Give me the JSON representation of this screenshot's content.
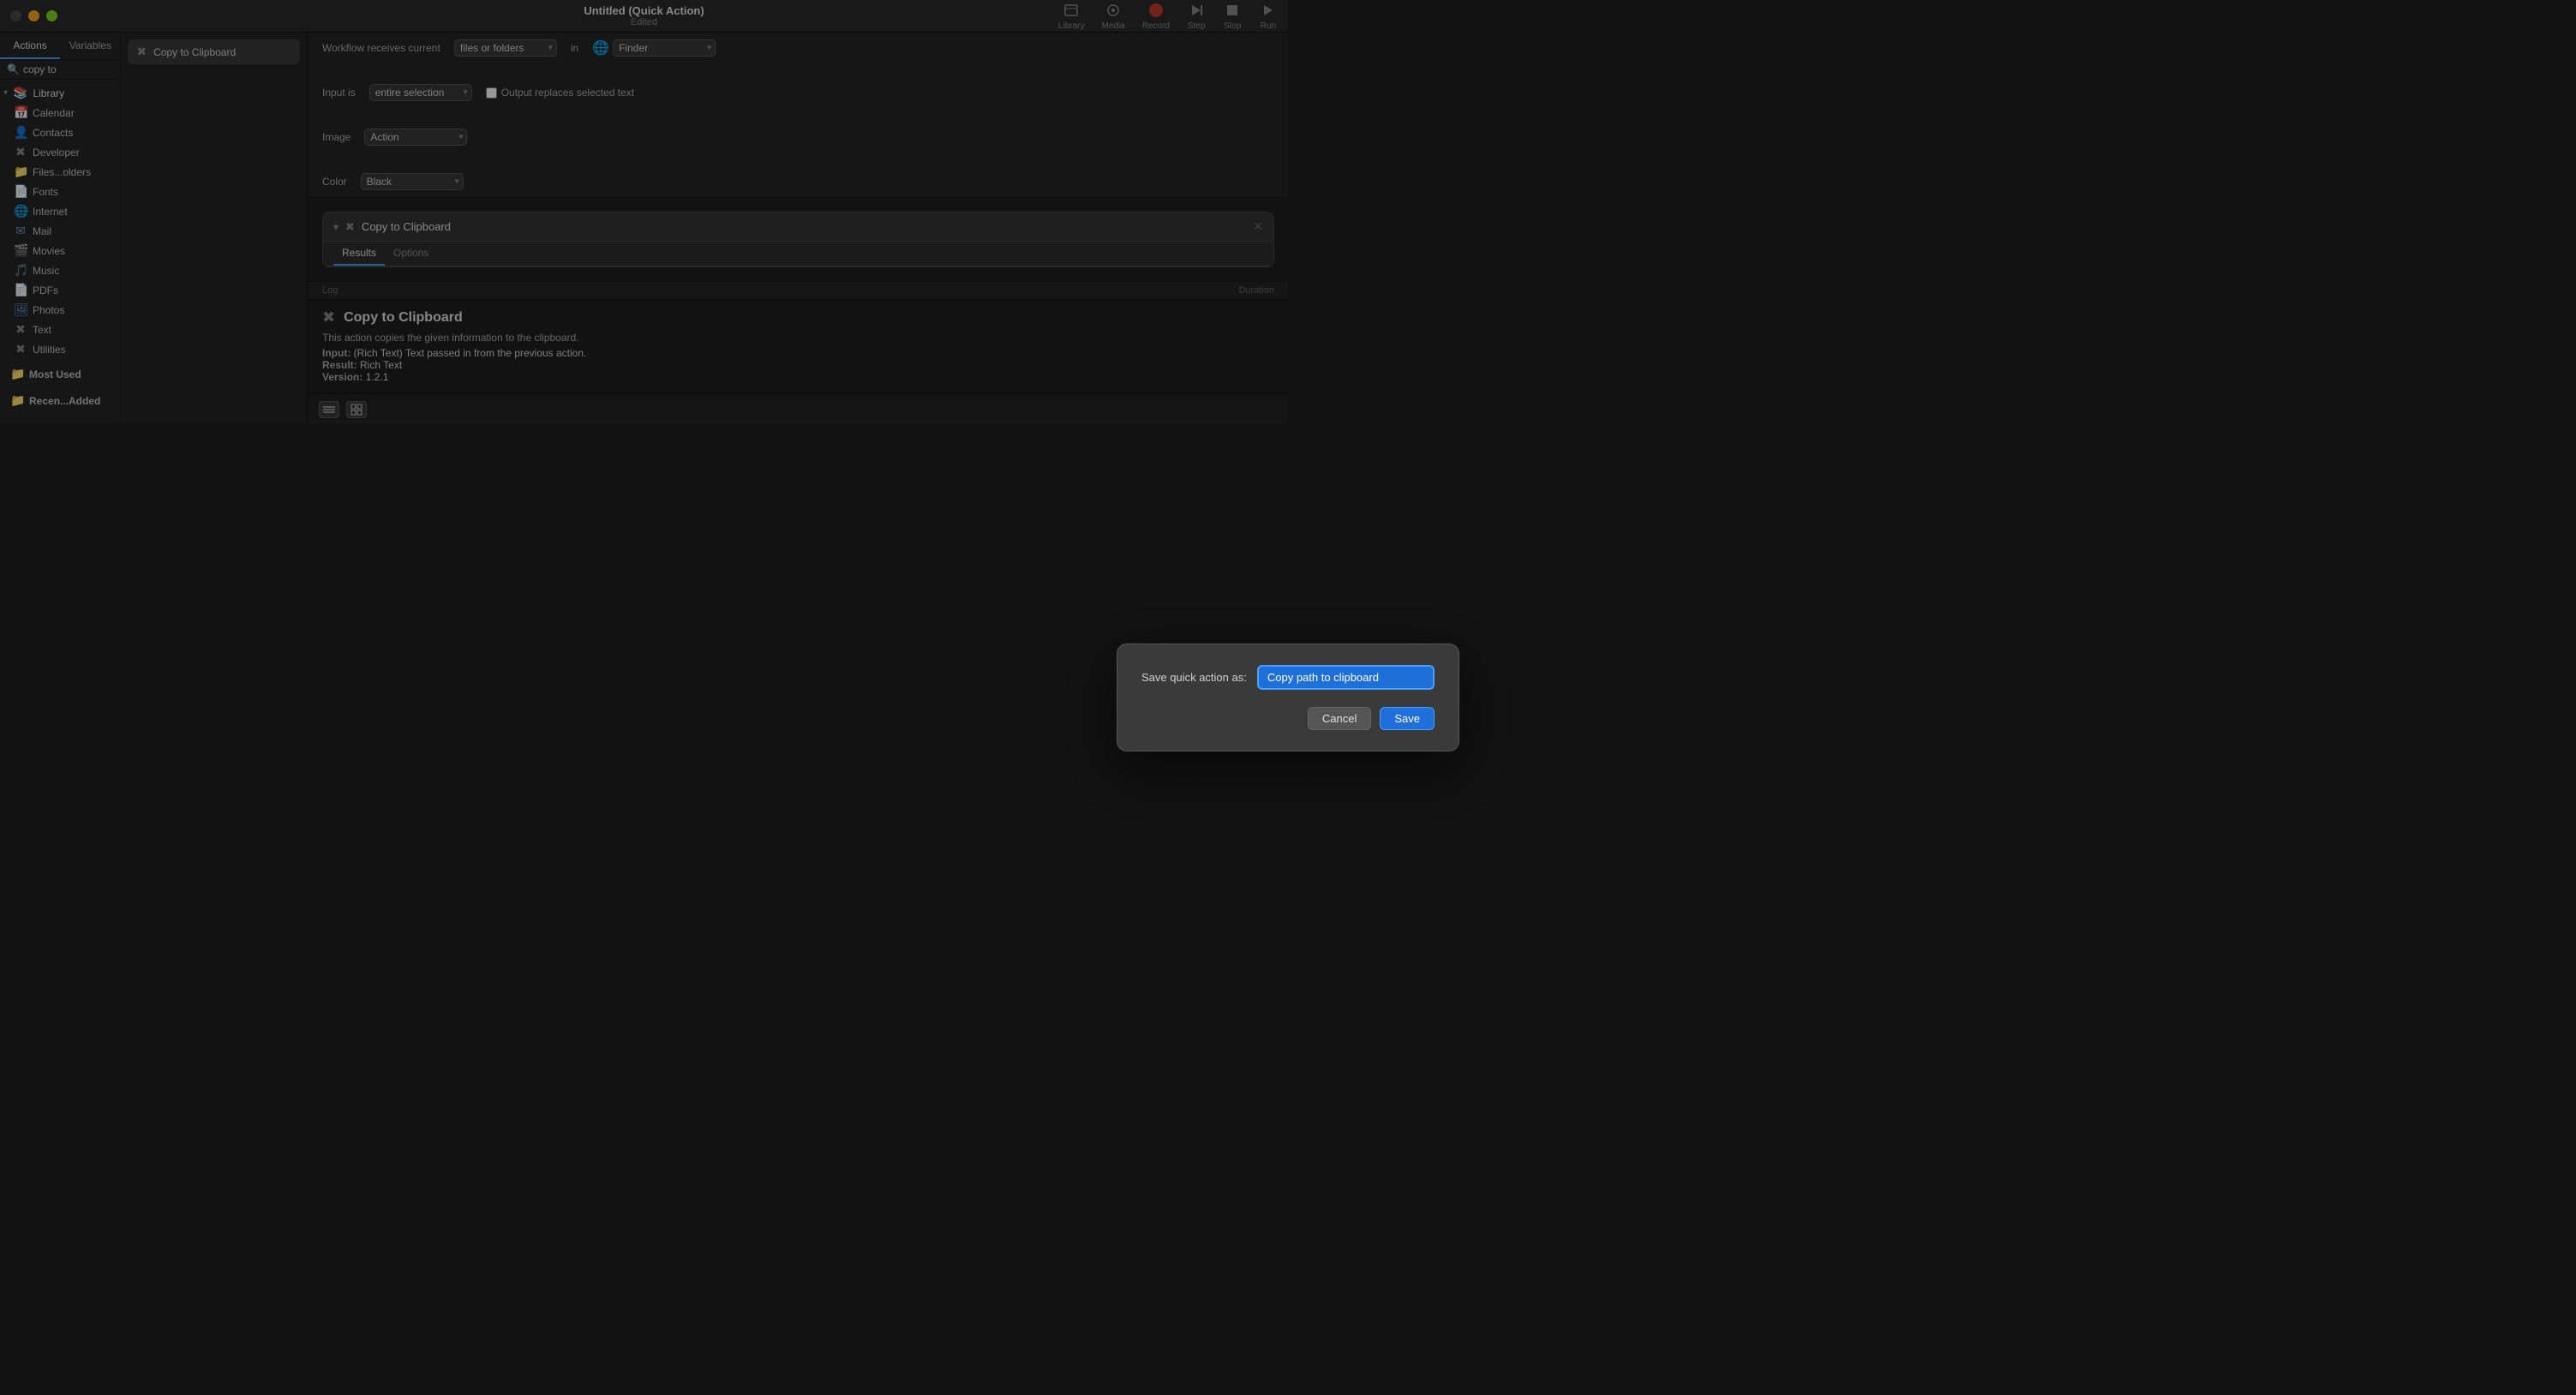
{
  "window": {
    "title": "Untitled (Quick Action)",
    "subtitle": "Edited"
  },
  "toolbar": {
    "library_label": "Library",
    "media_label": "Media",
    "record_label": "Record",
    "step_label": "Step",
    "stop_label": "Stop",
    "run_label": "Run"
  },
  "sidebar": {
    "tabs": [
      {
        "id": "actions",
        "label": "Actions"
      },
      {
        "id": "variables",
        "label": "Variables"
      }
    ],
    "search_placeholder": "copy to",
    "active_tab": "Actions",
    "tree": {
      "library_label": "Library",
      "items": [
        {
          "id": "calendar",
          "label": "Calendar",
          "icon": "📅",
          "type": "folder-yellow"
        },
        {
          "id": "contacts",
          "label": "Contacts",
          "icon": "👤",
          "type": "folder-orange"
        },
        {
          "id": "developer",
          "label": "Developer",
          "icon": "✖",
          "type": "folder-gray"
        },
        {
          "id": "files",
          "label": "Files...olders",
          "icon": "📁",
          "type": "folder-blue"
        },
        {
          "id": "fonts",
          "label": "Fonts",
          "icon": "📄",
          "type": "folder-gray"
        },
        {
          "id": "internet",
          "label": "Internet",
          "icon": "🌐",
          "type": "folder-blue"
        },
        {
          "id": "mail",
          "label": "Mail",
          "icon": "✉",
          "type": "folder-blue"
        },
        {
          "id": "movies",
          "label": "Movies",
          "icon": "🎬",
          "type": "folder-purple"
        },
        {
          "id": "music",
          "label": "Music",
          "icon": "🎵",
          "type": "folder-red"
        },
        {
          "id": "pdfs",
          "label": "PDFs",
          "icon": "📄",
          "type": "folder-red"
        },
        {
          "id": "photos",
          "label": "Photos",
          "icon": "🖼",
          "type": "folder-blue"
        },
        {
          "id": "text",
          "label": "Text",
          "icon": "✖",
          "type": "folder-gray"
        },
        {
          "id": "utilities",
          "label": "Utilities",
          "icon": "✖",
          "type": "folder-gray"
        }
      ],
      "sections": [
        {
          "label": "Most Used",
          "items": []
        },
        {
          "label": "Recen...Added",
          "items": []
        }
      ]
    }
  },
  "action_list": {
    "items": [
      {
        "id": "copy-to-clipboard",
        "label": "Copy to Clipboard"
      }
    ]
  },
  "workflow": {
    "receives_label": "Workflow receives current",
    "input_type": "files or folders",
    "in_label": "in",
    "app_name": "Finder",
    "input_is_label": "Input is",
    "input_value": "entire selection",
    "output_label": "Output replaces selected text",
    "image_label": "Image",
    "image_value": "Action",
    "color_label": "Color",
    "color_value": "Black"
  },
  "action_card": {
    "title": "Copy to Clipboard",
    "tabs": [
      {
        "id": "results",
        "label": "Results"
      },
      {
        "id": "options",
        "label": "Options"
      }
    ],
    "active_tab": "Results"
  },
  "log_bar": {
    "log_label": "Log",
    "duration_label": "Duration"
  },
  "bottom_panel": {
    "action_name": "Copy to Clipboard",
    "description": "This action copies the given information to the clipboard.",
    "input_label": "Input:",
    "input_value": "(Rich Text) Text passed in from the previous action.",
    "result_label": "Result:",
    "result_value": "Rich Text",
    "version_label": "Version:",
    "version_value": "1.2.1"
  },
  "modal": {
    "save_label": "Save quick action as:",
    "input_value": "Copy path to clipboard",
    "cancel_label": "Cancel",
    "save_button_label": "Save"
  },
  "colors": {
    "accent": "#4a9eff",
    "record_red": "#c0392b"
  }
}
